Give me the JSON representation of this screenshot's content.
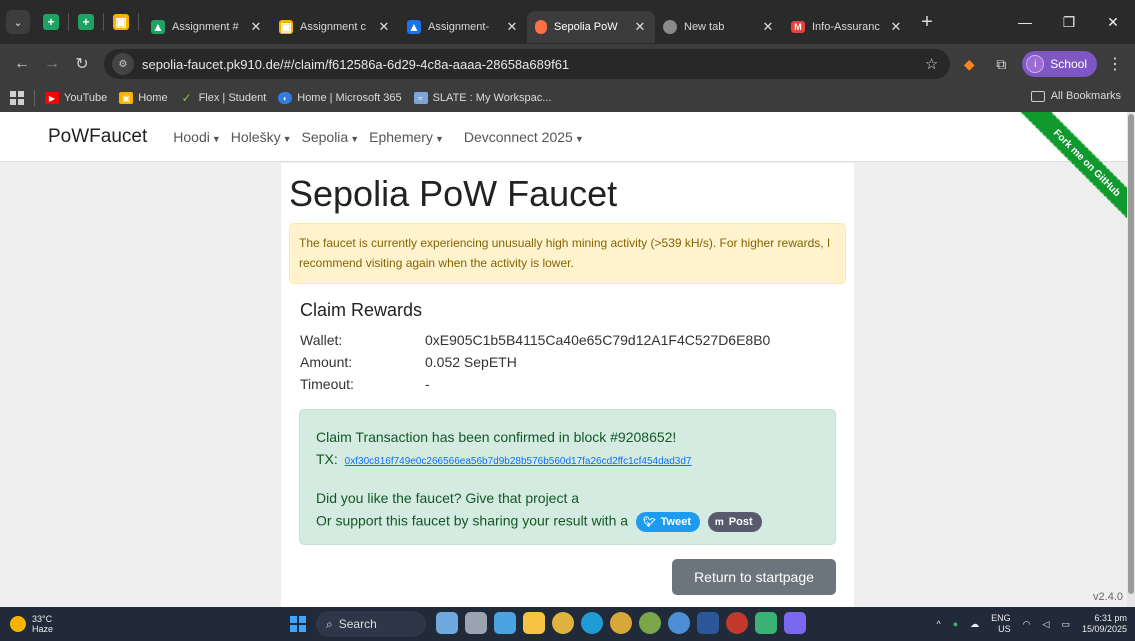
{
  "browser": {
    "tabs": [
      {
        "title": "Assignment #",
        "icon_color": "#1ea362",
        "active": false
      },
      {
        "title": "Assignment c",
        "icon_color": "#f4b400",
        "active": false
      },
      {
        "title": "Assignment-",
        "icon_color": "#1a73e8",
        "active": false
      },
      {
        "title": "Sepolia PoW",
        "icon_color": "#ff7043",
        "active": true
      },
      {
        "title": "New tab",
        "icon_color": "#aaaaaa",
        "active": false
      },
      {
        "title": "Info-Assuranc",
        "icon_color": "#ea4335",
        "active": false
      }
    ],
    "url": "sepolia-faucet.pk910.de/#/claim/f612586a-6d29-4c8a-aaaa-28658a689f61",
    "profile_label": "School",
    "profile_initial": "i",
    "bookmarks": [
      {
        "label": "YouTube",
        "icon_color": "#ff0000"
      },
      {
        "label": "Home",
        "icon_color": "#f4b400"
      },
      {
        "label": "Flex | Student",
        "icon_color": "#8bc34a"
      },
      {
        "label": "Home | Microsoft 365",
        "icon_color": "#2f7de1"
      },
      {
        "label": "SLATE : My Workspac...",
        "icon_color": "#7da6d8"
      }
    ],
    "all_bookmarks_label": "All Bookmarks"
  },
  "site": {
    "brand": "PoWFaucet",
    "nav": [
      "Hoodi",
      "Holešky",
      "Sepolia",
      "Ephemery",
      "Devconnect 2025"
    ],
    "title": "Sepolia PoW Faucet",
    "warning": "The faucet is currently experiencing unusually high mining activity (>539 kH/s). For higher rewards, I recommend visiting again when the activity is lower.",
    "claim": {
      "heading": "Claim Rewards",
      "wallet_label": "Wallet:",
      "wallet_value": "0xE905C1b5B4115Ca40e65C79d12A1F4C527D6E8B0",
      "amount_label": "Amount:",
      "amount_value": "0.052 SepETH",
      "timeout_label": "Timeout:",
      "timeout_value": "-"
    },
    "success": {
      "confirmed": "Claim Transaction has been confirmed in block #9208652!",
      "tx_label": "TX:",
      "tx_hash": "0xf30c816f749e0c266566ea56b7d9b28b576b560d17fa26cd2ffc1cf454dad3d7",
      "like_text": "Did you like the faucet? Give that project a",
      "support_text": "Or support this faucet by sharing your result with a",
      "tweet_label": "Tweet",
      "post_label": "Post"
    },
    "return_button": "Return to startpage",
    "ribbon": "Fork me on GitHub",
    "version": "v2.4.0"
  },
  "taskbar": {
    "temperature": "33°C",
    "weather": "Haze",
    "search_label": "Search",
    "lang": "ENG",
    "region": "US",
    "time": "6:31 pm",
    "date": "15/09/2025"
  }
}
